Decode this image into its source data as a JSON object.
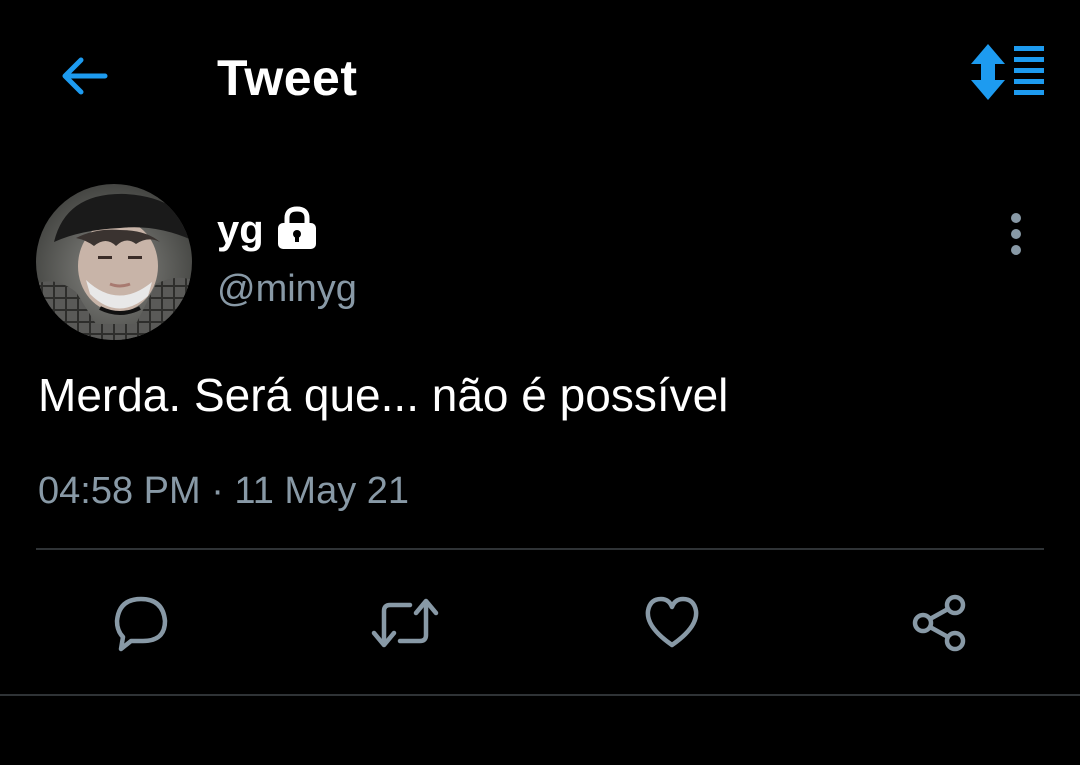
{
  "header": {
    "title": "Tweet",
    "back_icon": "arrow-left-icon",
    "sort_icon": "sort-arrows-icon"
  },
  "author": {
    "display_name": "yg",
    "handle": "@minyg",
    "protected_icon": "lock-icon",
    "more_icon": "more-vertical-icon"
  },
  "tweet": {
    "text": "Merda. Será que... não é possível",
    "timestamp": "04:58 PM · 11 May 21"
  },
  "actions": {
    "reply_icon": "reply-icon",
    "retweet_icon": "retweet-icon",
    "like_icon": "heart-icon",
    "share_icon": "share-icon"
  },
  "colors": {
    "background": "#000000",
    "accent": "#1d9bf0",
    "primary_text": "#ffffff",
    "secondary_text": "#8899a6",
    "divider": "#2f3336"
  }
}
